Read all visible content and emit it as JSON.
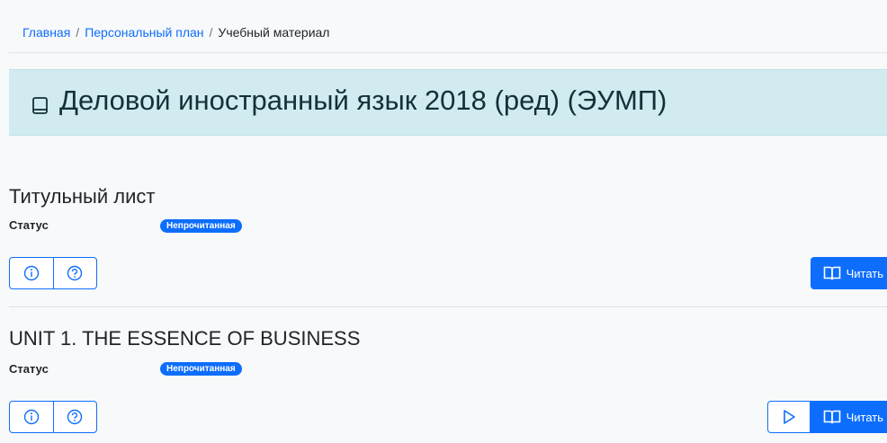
{
  "breadcrumb": {
    "home": "Главная",
    "plan": "Персональный план",
    "current": "Учебный материал",
    "separator": "/"
  },
  "course": {
    "title": "Деловой иностранный язык 2018 (ред) (ЭУМП)",
    "icon": "book-outline-icon"
  },
  "materials": [
    {
      "title": "Титульный лист",
      "status_label": "Статус",
      "status_badge": "Непрочитанная",
      "read_label": "Читать",
      "has_play": false
    },
    {
      "title": "UNIT 1. THE ESSENCE OF BUSINESS",
      "status_label": "Статус",
      "status_badge": "Непрочитанная",
      "read_label": "Читать",
      "has_play": true
    }
  ],
  "colors": {
    "accent": "#0d6efd",
    "banner_bg": "#d2ebf1",
    "page_bg": "#f8f9fa"
  }
}
